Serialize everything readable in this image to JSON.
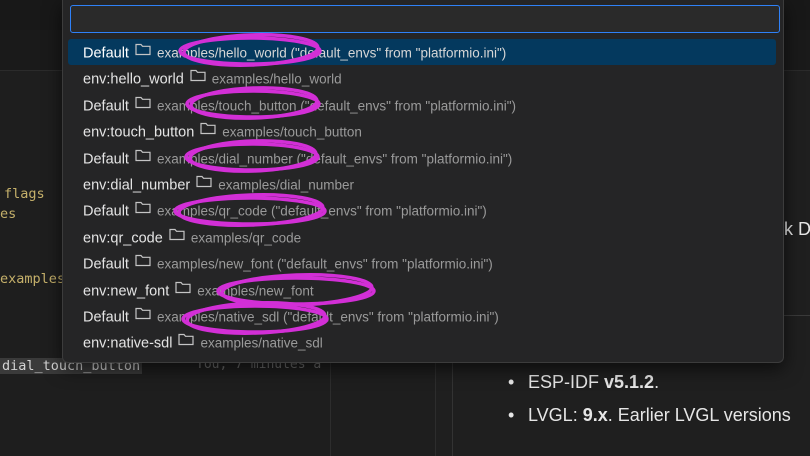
{
  "quick_pick": {
    "input_value": "",
    "input_placeholder": "",
    "items": [
      {
        "label": "Default",
        "description": "examples/hello_world (\"default_envs\" from \"platformio.ini\")",
        "active": true
      },
      {
        "label": "env:hello_world",
        "description": "examples/hello_world"
      },
      {
        "label": "Default",
        "description": "examples/touch_button (\"default_envs\" from \"platformio.ini\")"
      },
      {
        "label": "env:touch_button",
        "description": "examples/touch_button"
      },
      {
        "label": "Default",
        "description": "examples/dial_number (\"default_envs\" from \"platformio.ini\")"
      },
      {
        "label": "env:dial_number",
        "description": "examples/dial_number"
      },
      {
        "label": "Default",
        "description": "examples/qr_code (\"default_envs\" from \"platformio.ini\")"
      },
      {
        "label": "env:qr_code",
        "description": "examples/qr_code"
      },
      {
        "label": "Default",
        "description": "examples/new_font (\"default_envs\" from \"platformio.ini\")"
      },
      {
        "label": "env:new_font",
        "description": "examples/new_font"
      },
      {
        "label": "Default",
        "description": "examples/native_sdl (\"default_envs\" from \"platformio.ini\")"
      },
      {
        "label": "env:native-sdl",
        "description": "examples/native_sdl"
      }
    ],
    "item_icon": "folder-icon"
  },
  "editor": {
    "code_lines": [
      "flags",
      "es",
      "examples",
      "dial_touch_button"
    ],
    "blame": "You, 7 minutes a"
  },
  "preview": {
    "partial_heading": "k D",
    "bullets": [
      {
        "text": "ESP-IDF ",
        "bold": "v5.1.2",
        "suffix": "."
      },
      {
        "text": "LVGL: ",
        "bold": "9.x",
        "suffix": ". Earlier LVGL versions"
      }
    ]
  },
  "colors": {
    "accent": "#2f81f7",
    "selection": "#04395e",
    "annotation": "#d22fd6"
  }
}
